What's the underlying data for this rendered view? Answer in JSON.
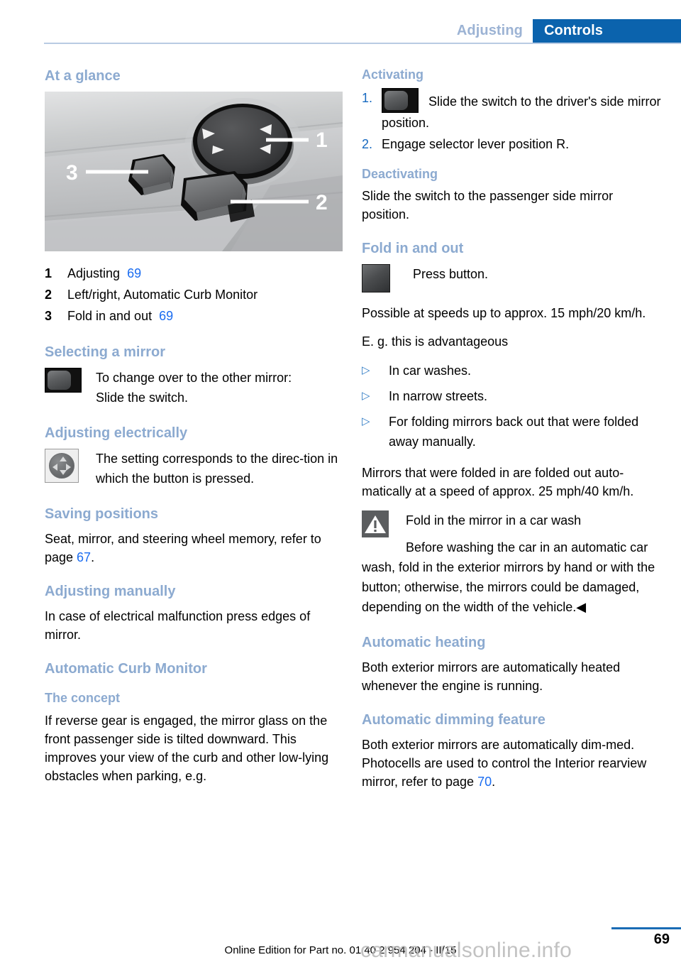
{
  "header": {
    "breadcrumb_secondary": "Adjusting",
    "breadcrumb_primary": "Controls",
    "accent_blue": "#0b63ad",
    "muted_blue": "#9cb3d4"
  },
  "colors": {
    "heading_blue": "#8caad0",
    "link_blue": "#1a6cf0",
    "step_blue": "#1769c0",
    "bullet_blue": "#2e7ac4",
    "warning_gray": "#5b5d5f"
  },
  "left_column": {
    "at_a_glance": {
      "heading": "At a glance",
      "figure_alt": "Door panel exterior mirror control cluster with joystick, selector rocker and fold button",
      "legend": [
        {
          "num": "1",
          "label": "Adjusting",
          "page": "69"
        },
        {
          "num": "2",
          "label": "Left/right, Automatic Curb Monitor",
          "page": ""
        },
        {
          "num": "3",
          "label": "Fold in and out",
          "page": "69"
        }
      ]
    },
    "selecting_a_mirror": {
      "heading": "Selecting a mirror",
      "icon": "rocker-switch-icon",
      "line1": "To change over to the other mirror:",
      "line2": "Slide the switch."
    },
    "adjusting_electrically": {
      "heading": "Adjusting electrically",
      "icon": "dpad-icon",
      "text": "The setting corresponds to the direc-tion in which the button is pressed."
    },
    "saving_positions": {
      "heading": "Saving positions",
      "text_before": "Seat, mirror, and steering wheel memory, refer to page ",
      "page": "67",
      "text_after": "."
    },
    "adjusting_manually": {
      "heading": "Adjusting manually",
      "text": "In case of electrical malfunction press edges of mirror."
    },
    "automatic_curb_monitor": {
      "heading": "Automatic Curb Monitor",
      "concept_heading": "The concept",
      "concept_text": "If reverse gear is engaged, the mirror glass on the front passenger side is tilted downward. This improves your view of the curb and other low-lying obstacles when parking, e.g."
    }
  },
  "right_column": {
    "activating": {
      "heading": "Activating",
      "steps": [
        {
          "num": "1.",
          "icon": "rocker-switch-icon",
          "text": "Slide the switch to the driver's side mirror position."
        },
        {
          "num": "2.",
          "icon": "",
          "text": "Engage selector lever position R."
        }
      ]
    },
    "deactivating": {
      "heading": "Deactivating",
      "text": "Slide the switch to the passenger side mirror position."
    },
    "fold_in_and_out": {
      "heading": "Fold in and out",
      "icon": "square-button-icon",
      "press_text": "Press button.",
      "speed_text": "Possible at speeds up to approx. 15 mph/20 km/h.",
      "eg_text": "E. g. this is advantageous",
      "bullets": [
        "In car washes.",
        "In narrow streets.",
        "For folding mirrors back out that were folded away manually."
      ],
      "auto_text": "Mirrors that were folded in are folded out auto-matically at a speed of approx. 25 mph/40 km/h.",
      "warning": {
        "icon": "warning-triangle-icon",
        "title": "Fold in the mirror in a car wash",
        "body": "Before washing the car in an automatic car wash, fold in the exterior mirrors by hand or with the button; otherwise, the mirrors could be damaged, depending on the width of the vehicle.",
        "end_mark": "◀"
      }
    },
    "automatic_heating": {
      "heading": "Automatic heating",
      "text": "Both exterior mirrors are automatically heated whenever the engine is running."
    },
    "automatic_dimming": {
      "heading": "Automatic dimming feature",
      "text_before": "Both exterior mirrors are automatically dim-med. Photocells are used to control the Interior rearview mirror, refer to page ",
      "page": "70",
      "text_after": "."
    }
  },
  "footer": {
    "page_number": "69",
    "edition_note": "Online Edition for Part no. 01 40 2 954 204 - II/15",
    "watermark": "carmanualsonline.info"
  }
}
